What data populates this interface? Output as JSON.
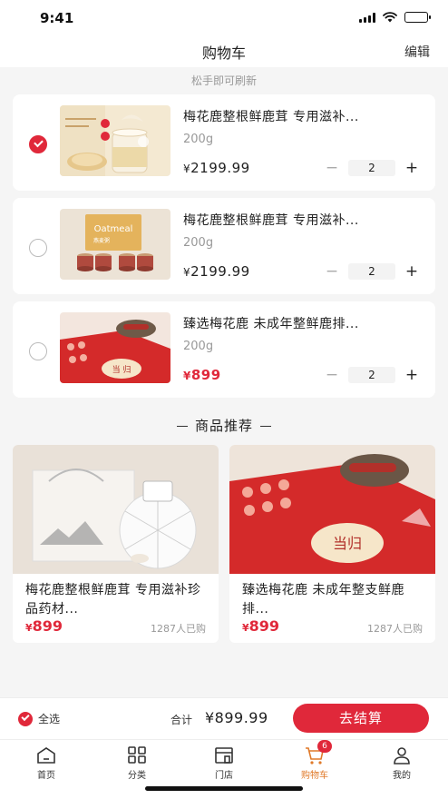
{
  "status_bar": {
    "time": "9:41"
  },
  "nav": {
    "title": "购物车",
    "edit_label": "编辑"
  },
  "refresh_hint": "松手即可刷新",
  "cart_items": [
    {
      "title": "梅花鹿整根鲜鹿茸 专用滋补...",
      "spec": "200g",
      "currency": "¥",
      "price": "2199.99",
      "quantity": "2",
      "checked": true
    },
    {
      "title": "梅花鹿整根鲜鹿茸 专用滋补...",
      "spec": "200g",
      "currency": "¥",
      "price": "2199.99",
      "quantity": "2",
      "checked": false
    },
    {
      "title": "臻选梅花鹿 未成年整鲜鹿排...",
      "spec": "200g",
      "currency": "¥",
      "price": "899",
      "quantity": "2",
      "checked": false
    }
  ],
  "product_images": {
    "item_0_label": "Oatmeal",
    "item_1_label": "Oatmeal",
    "item_1_sub": "燕麦粥"
  },
  "stepper": {
    "minus": "−",
    "plus": "+"
  },
  "recommend": {
    "header": "商品推荐",
    "items": [
      {
        "title": "梅花鹿整根鲜鹿茸  专用滋补珍品药材...",
        "currency": "¥",
        "price": "899",
        "sold": "1287人已购"
      },
      {
        "title": "臻选梅花鹿  未成年整支鲜鹿排...",
        "currency": "¥",
        "price": "899",
        "sold": "1287人已购"
      }
    ]
  },
  "checkout": {
    "select_all": "全选",
    "total_label": "合计",
    "total_value": "¥899.99",
    "button": "去结算"
  },
  "tabs": [
    {
      "label": "首页",
      "icon": "home-icon"
    },
    {
      "label": "分类",
      "icon": "grid-icon"
    },
    {
      "label": "门店",
      "icon": "store-icon"
    },
    {
      "label": "购物车",
      "icon": "cart-icon",
      "badge": "6",
      "active": true
    },
    {
      "label": "我的",
      "icon": "user-icon"
    }
  ],
  "colors": {
    "accent": "#e0283a",
    "active_tab": "#e07a2a"
  }
}
